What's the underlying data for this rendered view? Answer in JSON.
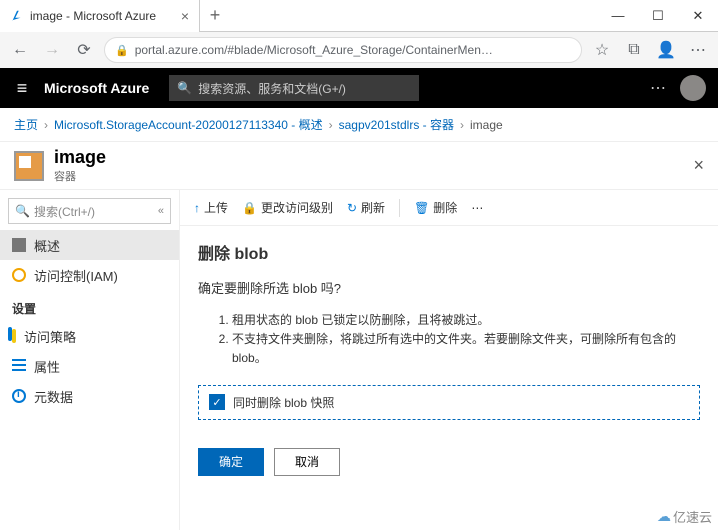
{
  "window": {
    "tab_title": "image - Microsoft Azure",
    "url": "portal.azure.com/#blade/Microsoft_Azure_Storage/ContainerMen…"
  },
  "topbar": {
    "brand": "Microsoft Azure",
    "search_placeholder": "搜索资源、服务和文档(G+/)"
  },
  "breadcrumbs": {
    "b1": "主页",
    "b2": "Microsoft.StorageAccount-20200127113340 - 概述",
    "b3": "sagpv201stdlrs - 容器",
    "b4": "image"
  },
  "resource": {
    "name": "image",
    "type": "容器"
  },
  "nav": {
    "search_placeholder": "搜索(Ctrl+/)",
    "overview": "概述",
    "iam": "访问控制(IAM)",
    "settings_hdr": "设置",
    "policy": "访问策略",
    "props": "属性",
    "meta": "元数据"
  },
  "toolbar": {
    "upload": "上传",
    "access": "更改访问级别",
    "refresh": "刷新",
    "delete": "删除"
  },
  "dialog": {
    "title": "删除 blob",
    "question": "确定要删除所选 blob 吗?",
    "li1": "租用状态的 blob 已锁定以防删除，且将被跳过。",
    "li2": "不支持文件夹删除，将跳过所有选中的文件夹。若要删除文件夹，可删除所有包含的 blob。",
    "checkbox": "同时删除 blob 快照",
    "ok": "确定",
    "cancel": "取消"
  },
  "watermark": "亿速云"
}
